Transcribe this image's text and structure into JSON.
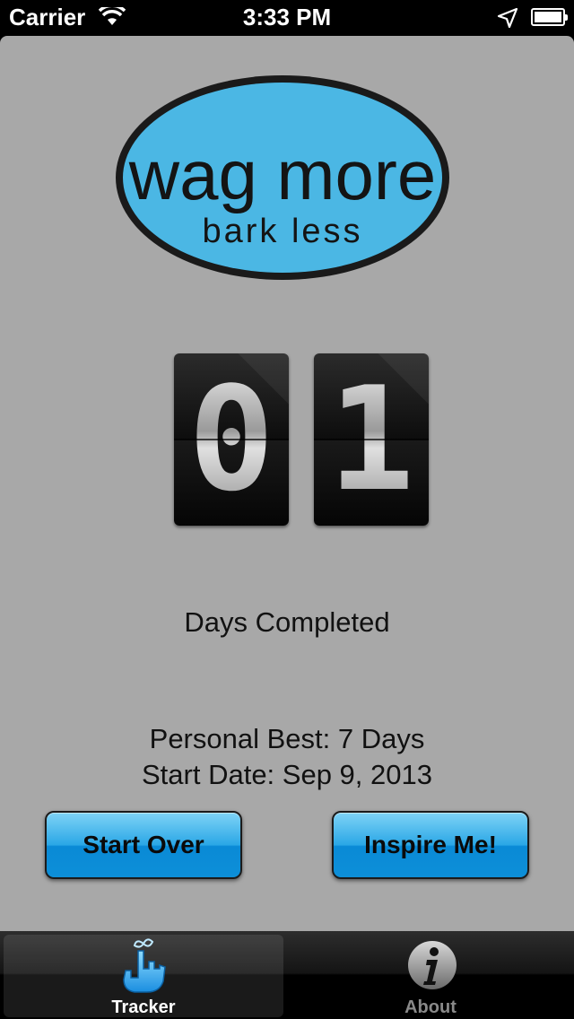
{
  "status_bar": {
    "carrier": "Carrier",
    "time": "3:33 PM"
  },
  "logo": {
    "line1": "wag more",
    "line2": "bark less"
  },
  "counter": {
    "digits": [
      "0",
      "1"
    ]
  },
  "labels": {
    "days_completed": "Days Completed",
    "personal_best": "Personal Best: 7 Days",
    "start_date": "Start Date: Sep 9, 2013"
  },
  "buttons": {
    "start_over": "Start Over",
    "inspire_me": "Inspire Me!"
  },
  "tabs": [
    {
      "label": "Tracker",
      "icon": "finger-string-icon",
      "selected": true
    },
    {
      "label": "About",
      "icon": "info-icon",
      "selected": false
    }
  ],
  "colors": {
    "logo_blue": "#4bb7e4",
    "button_blue": "#1a9de0",
    "background": "#a8a8a8"
  }
}
